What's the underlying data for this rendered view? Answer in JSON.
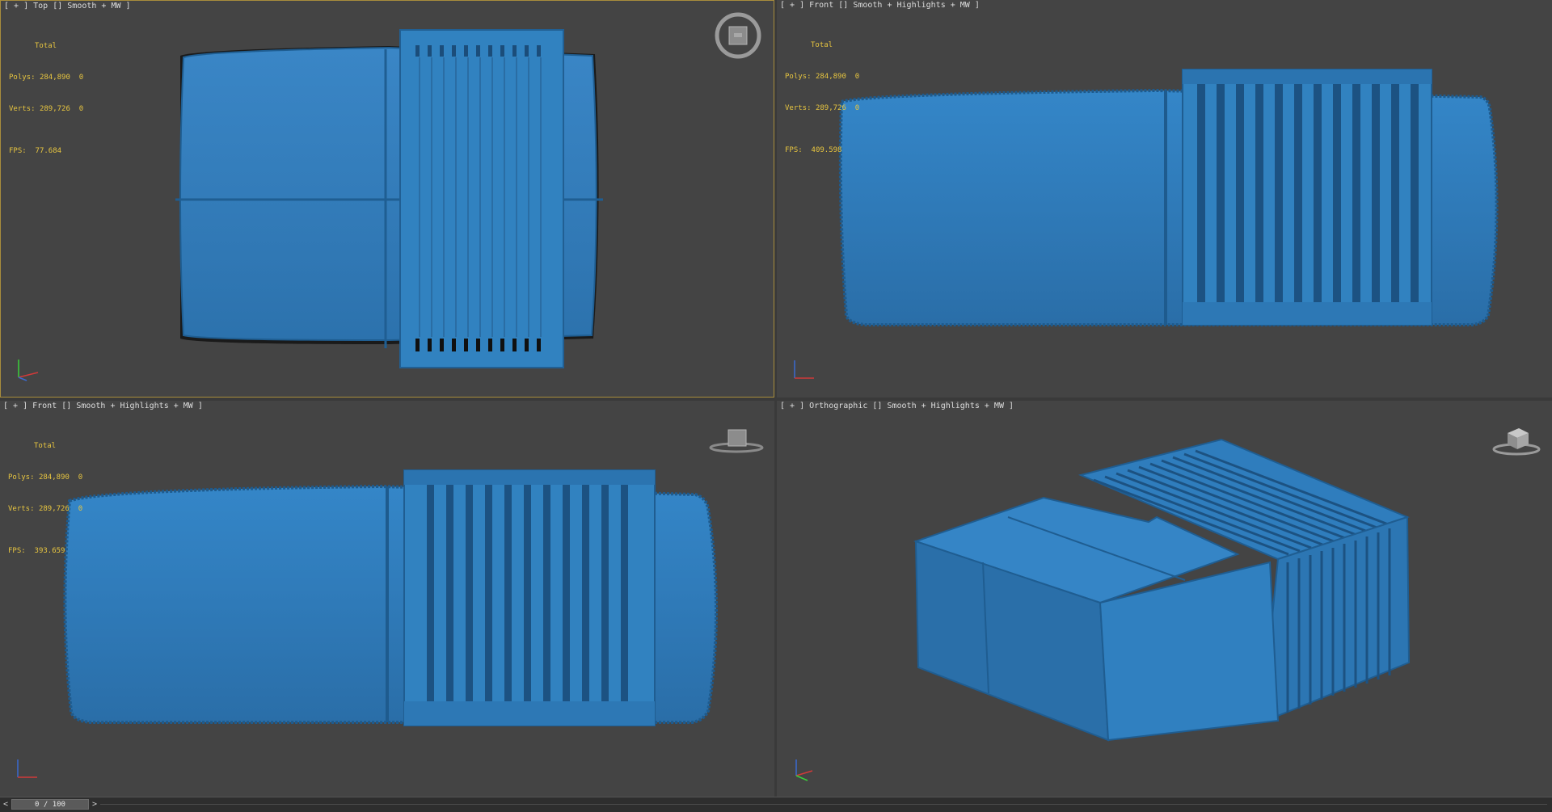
{
  "viewports": [
    {
      "id": "top",
      "label_prefix": "[ + ] ",
      "view": "Top",
      "sep1": " [] ",
      "mode": "Smooth + MW",
      "suffix": " ]",
      "stats": {
        "header": "Total",
        "polys_label": "Polys:",
        "polys": "284,890",
        "polys_sel": "0",
        "verts_label": "Verts:",
        "verts": "289,726",
        "verts_sel": "0",
        "fps_label": "FPS:",
        "fps": "77.684"
      }
    },
    {
      "id": "front-1",
      "label_prefix": "[ + ] ",
      "view": "Front",
      "sep1": " [] ",
      "mode": "Smooth + Highlights + MW",
      "suffix": " ]",
      "stats": {
        "header": "Total",
        "polys_label": "Polys:",
        "polys": "284,890",
        "polys_sel": "0",
        "verts_label": "Verts:",
        "verts": "289,726",
        "verts_sel": "0",
        "fps_label": "FPS:",
        "fps": "409.598"
      }
    },
    {
      "id": "front-2",
      "label_prefix": "[ + ] ",
      "view": "Front",
      "sep1": " [] ",
      "mode": "Smooth + Highlights + MW",
      "suffix": " ]",
      "stats": {
        "header": "Total",
        "polys_label": "Polys:",
        "polys": "284,890",
        "polys_sel": "0",
        "verts_label": "Verts:",
        "verts": "289,726",
        "verts_sel": "0",
        "fps_label": "FPS:",
        "fps": "393.659"
      }
    },
    {
      "id": "ortho",
      "label_prefix": "[ + ] ",
      "view": "Orthographic",
      "sep1": " [] ",
      "mode": "Smooth + Highlights + MW",
      "suffix": " ]",
      "stats": null
    }
  ],
  "timeline": {
    "prev": "<",
    "frame": "0 / 100",
    "next": ">"
  },
  "icons": {
    "viewcube": "viewcube-icon",
    "axis": "axis-tripod-icon"
  },
  "colors": {
    "model_blue": "#2f7ab8",
    "active_border": "#a88d3c",
    "stats_text": "#e8c640"
  }
}
